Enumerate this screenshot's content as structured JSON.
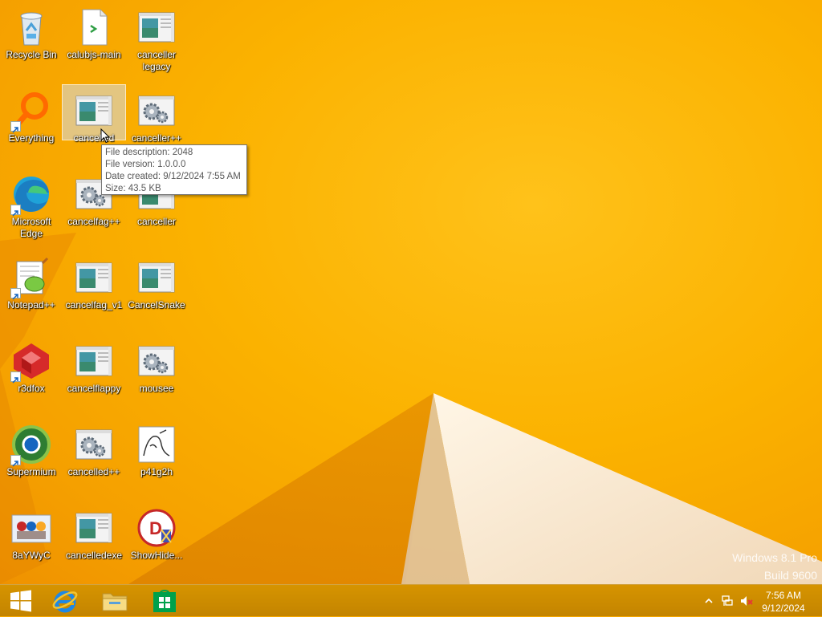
{
  "desktop": {
    "icons": [
      {
        "name": "Recycle Bin",
        "shortcut": false,
        "kind": "recycle"
      },
      {
        "name": "calubjs-main",
        "shortcut": false,
        "kind": "doc"
      },
      {
        "name": "canceller legacy",
        "shortcut": false,
        "kind": "window"
      },
      {
        "name": "Everything",
        "shortcut": true,
        "kind": "everything"
      },
      {
        "name": "cancelled",
        "shortcut": false,
        "kind": "window",
        "selected": true
      },
      {
        "name": "canceller++",
        "shortcut": false,
        "kind": "gear"
      },
      {
        "name": "Microsoft Edge",
        "shortcut": true,
        "kind": "edge"
      },
      {
        "name": "cancelfag++",
        "shortcut": false,
        "kind": "gear"
      },
      {
        "name": "canceller",
        "shortcut": false,
        "kind": "window"
      },
      {
        "name": "Notepad++",
        "shortcut": true,
        "kind": "notepadpp"
      },
      {
        "name": "cancelfag_v1",
        "shortcut": false,
        "kind": "window"
      },
      {
        "name": "CancelSnake",
        "shortcut": false,
        "kind": "window"
      },
      {
        "name": "r3dfox",
        "shortcut": true,
        "kind": "r3dfox"
      },
      {
        "name": "cancelflappy",
        "shortcut": false,
        "kind": "window"
      },
      {
        "name": "mousee",
        "shortcut": false,
        "kind": "gear"
      },
      {
        "name": "Supermium",
        "shortcut": true,
        "kind": "supermium"
      },
      {
        "name": "cancelled++",
        "shortcut": false,
        "kind": "gear"
      },
      {
        "name": "p41g2h",
        "shortcut": false,
        "kind": "sketch"
      },
      {
        "name": "8aYWyC",
        "shortcut": false,
        "kind": "photo"
      },
      {
        "name": "cancelledexe",
        "shortcut": false,
        "kind": "window"
      },
      {
        "name": "ShowHide...",
        "shortcut": false,
        "kind": "showhide"
      }
    ]
  },
  "tooltip": {
    "description": "File description: 2048",
    "version": "File version: 1.0.0.0",
    "created": "Date created: 9/12/2024 7:55 AM",
    "size": "Size: 43.5 KB"
  },
  "watermark": {
    "line1": "Windows 8.1 Pro",
    "line2": "Build 9600"
  },
  "taskbar": {
    "start_icon": "windows-logo-icon",
    "pinned": [
      "internet-explorer-icon",
      "file-explorer-icon",
      "store-icon"
    ],
    "tray_icons": [
      "show-hidden-icons-chevron",
      "network-icon",
      "volume-muted-icon"
    ],
    "time": "7:56 AM",
    "date": "9/12/2024"
  },
  "colors": {
    "wallpaper": "#f7a800",
    "taskbar": "#c78a00"
  }
}
